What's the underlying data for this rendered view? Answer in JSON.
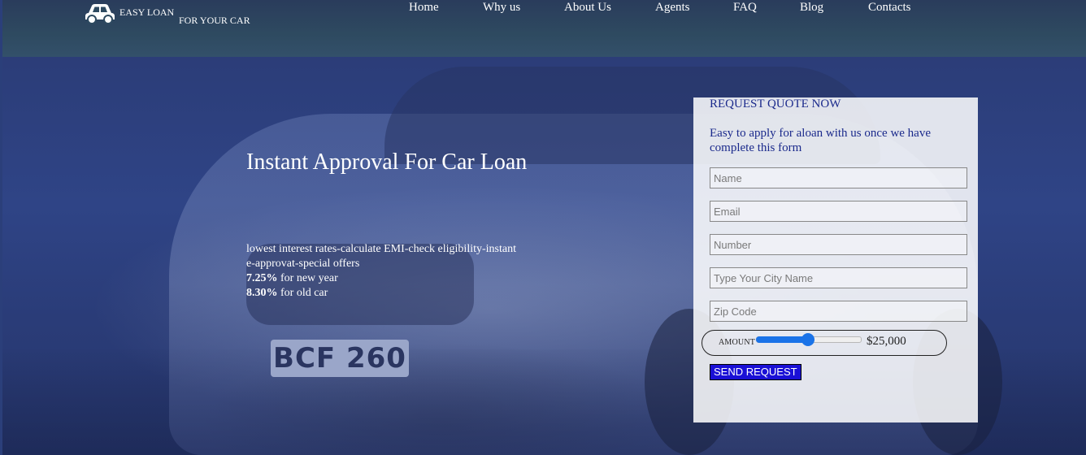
{
  "header": {
    "brand": {
      "icon": "car-icon",
      "name": "EASY LOAN",
      "tagline": "FOR YOUR CAR"
    },
    "nav": [
      {
        "label": "Home"
      },
      {
        "label": "Why us"
      },
      {
        "label": "About Us"
      },
      {
        "label": "Agents"
      },
      {
        "label": "FAQ"
      },
      {
        "label": "Blog"
      },
      {
        "label": "Contacts"
      }
    ]
  },
  "hero": {
    "title": "Instant Approval For Car Loan",
    "description_line1": "lowest interest rates-calculate EMI-check eligibility-instant",
    "description_line2": "e-approvat-special offers",
    "rate_new": "7.25%",
    "rate_new_label": " for new year",
    "rate_old": "8.30%",
    "rate_old_label": " for old car",
    "background_plate_text": "BCF 260"
  },
  "quote_form": {
    "title": "REQUEST QUOTE NOW",
    "subtitle": "Easy to apply for aloan with us once we have complete this form",
    "fields": {
      "name": {
        "placeholder": "Name",
        "value": ""
      },
      "email": {
        "placeholder": "Email",
        "value": ""
      },
      "number": {
        "placeholder": "Number",
        "value": ""
      },
      "city": {
        "placeholder": "Type Your City Name",
        "value": ""
      },
      "zip": {
        "placeholder": "Zip Code",
        "value": ""
      }
    },
    "amount": {
      "label": "AMOUNT",
      "value_text": "$25,000",
      "slider_fraction": 0.5
    },
    "submit_label": "SEND REQUEST"
  },
  "colors": {
    "overlay_blue": "#2b3f7a",
    "form_text": "#1b2a8c",
    "slider_blue": "#1a73e8",
    "button_blue": "#1a10d6"
  }
}
